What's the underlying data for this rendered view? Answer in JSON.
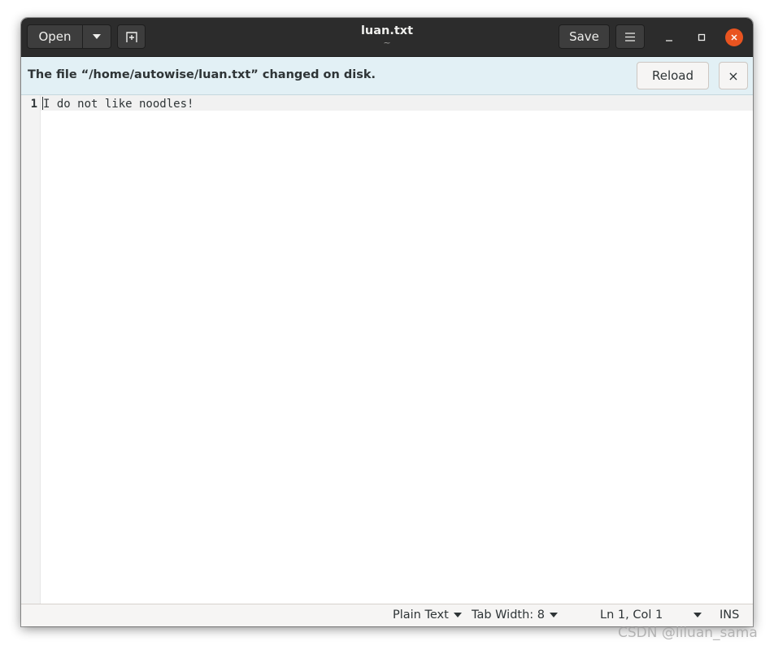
{
  "header": {
    "open_label": "Open",
    "save_label": "Save",
    "title": "luan.txt",
    "subtitle": "~"
  },
  "infobar": {
    "message": "The file “/home/autowise/luan.txt” changed on disk.",
    "reload_label": "Reload",
    "dismiss_label": "×"
  },
  "editor": {
    "line_numbers": [
      "1"
    ],
    "lines": [
      "I do not like noodles!"
    ]
  },
  "statusbar": {
    "language": "Plain Text",
    "tab_width": "Tab Width: 8",
    "position": "Ln 1, Col 1",
    "mode": "INS"
  },
  "watermark": "CSDN @liluan_sama",
  "icons": {
    "open_menu": "chevron-down-icon",
    "new_tab": "new-tab-icon",
    "menu": "hamburger-icon",
    "minimize": "minimize-icon",
    "maximize": "maximize-icon",
    "close": "close-icon"
  },
  "colors": {
    "headerbar": "#2c2c2c",
    "close_button": "#e95420",
    "infobar": "#e2f0f5"
  }
}
